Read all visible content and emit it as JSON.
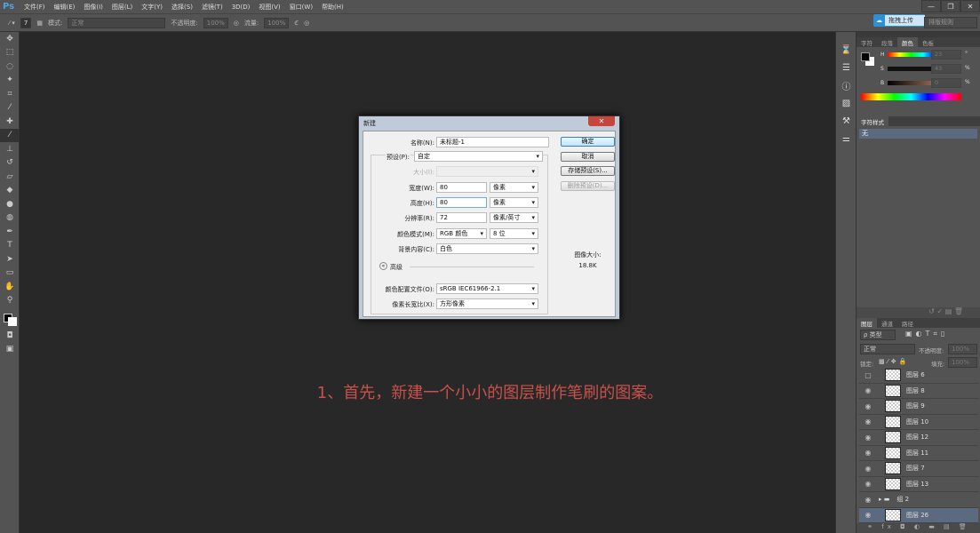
{
  "app": {
    "logo": "Ps"
  },
  "menu": [
    "文件(F)",
    "编辑(E)",
    "图像(I)",
    "图层(L)",
    "文字(Y)",
    "选择(S)",
    "滤镜(T)",
    "3D(D)",
    "视图(V)",
    "窗口(W)",
    "帮助(H)"
  ],
  "window_buttons": [
    "—",
    "❐",
    "✕"
  ],
  "options": {
    "brush_size": "7",
    "mode_label": "模式:",
    "mode_value": "正常",
    "opacity_label": "不透明度:",
    "opacity_value": "100%",
    "flow_label": "流量:",
    "flow_value": "100%"
  },
  "upload": {
    "label": "拖拽上传"
  },
  "sort": {
    "label": "排版规则"
  },
  "color_panel": {
    "tabs": [
      "字符",
      "段落",
      "颜色",
      "色板"
    ],
    "active_tab": "颜色",
    "h_label": "H",
    "h_value": "23",
    "h_unit": "°",
    "s_label": "S",
    "s_value": "43",
    "s_unit": "%",
    "b_label": "B",
    "b_value": "0",
    "b_unit": "%"
  },
  "char_style_panel": {
    "tab": "字符样式",
    "item": "无"
  },
  "layers_panel": {
    "tabs": [
      "图层",
      "通道",
      "路径"
    ],
    "active_tab": "图层",
    "filter_label": "ρ 类型",
    "blend_mode": "正常",
    "opacity_label": "不透明度:",
    "opacity_value": "100%",
    "lock_label": "锁定:",
    "fill_label": "填充:",
    "fill_value": "100%",
    "layers": [
      {
        "name": "图层 6",
        "visible": false
      },
      {
        "name": "图层 8",
        "visible": true
      },
      {
        "name": "图层 9",
        "visible": true
      },
      {
        "name": "图层 10",
        "visible": true
      },
      {
        "name": "图层 12",
        "visible": true
      },
      {
        "name": "图层 11",
        "visible": true
      },
      {
        "name": "图层 7",
        "visible": true
      },
      {
        "name": "图层 13",
        "visible": true
      },
      {
        "name": "组 2",
        "visible": true,
        "group": true
      },
      {
        "name": "图层 26",
        "visible": true,
        "selected": true
      }
    ]
  },
  "dialog": {
    "title": "新建",
    "close": "✕",
    "name_label": "名称(N):",
    "name_value": "未标题-1",
    "preset_label": "预设(P):",
    "preset_value": "自定",
    "size_label": "大小(I):",
    "size_value": "",
    "width_label": "宽度(W):",
    "width_value": "80",
    "width_unit": "像素",
    "height_label": "高度(H):",
    "height_value": "80",
    "height_unit": "像素",
    "resolution_label": "分辨率(R):",
    "resolution_value": "72",
    "resolution_unit": "像素/英寸",
    "colormode_label": "颜色模式(M):",
    "colormode_value": "RGB 颜色",
    "bitdepth_value": "8 位",
    "background_label": "背景内容(C):",
    "background_value": "白色",
    "advanced_label": "高级",
    "profile_label": "颜色配置文件(O):",
    "profile_value": "sRGB IEC61966-2.1",
    "aspect_label": "像素长宽比(X):",
    "aspect_value": "方形像素",
    "ok": "确定",
    "cancel": "取消",
    "save_preset": "存储预设(S)...",
    "delete_preset": "删除预设(D)...",
    "image_size_label": "图像大小:",
    "image_size_value": "18.8K"
  },
  "caption": "1、首先，新建一个小小的图层制作笔刷的图案。",
  "colors": {
    "caption": "#c9514b",
    "canvas": "#282828",
    "panel": "#535353",
    "selected_layer": "#5b6a7e"
  }
}
